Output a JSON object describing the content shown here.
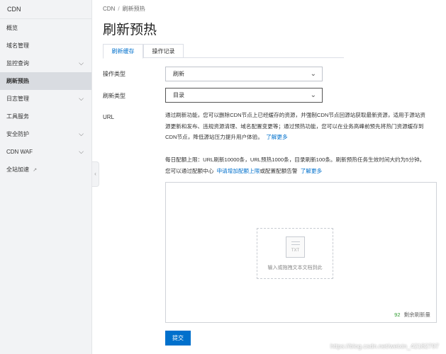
{
  "sidebar": {
    "title": "CDN",
    "items": [
      {
        "label": "概览",
        "has_chevron": false
      },
      {
        "label": "域名管理",
        "has_chevron": false
      },
      {
        "label": "监控查询",
        "has_chevron": true
      },
      {
        "label": "刷新预热",
        "has_chevron": false,
        "active": true
      },
      {
        "label": "日志管理",
        "has_chevron": true
      },
      {
        "label": "工具服务",
        "has_chevron": false
      },
      {
        "label": "安全防护",
        "has_chevron": true
      },
      {
        "label": "CDN WAF",
        "has_chevron": true
      },
      {
        "label": "全站加速",
        "has_chevron": false,
        "external": true
      }
    ]
  },
  "breadcrumb": {
    "root": "CDN",
    "separator": "/",
    "current": "刷新预热"
  },
  "page_title": "刷新预热",
  "tabs": [
    {
      "label": "刷新缓存",
      "active": true
    },
    {
      "label": "操作记录",
      "active": false
    }
  ],
  "form": {
    "operation_type": {
      "label": "操作类型",
      "value": "刷新"
    },
    "refresh_type": {
      "label": "刷新类型",
      "value": "目录"
    },
    "url": {
      "label": "URL",
      "desc_line1": "通过刷新功能，您可以删除CDN节点上已经缓存的资源，并强制CDN节点回源站获取最新资源，适用于源站资",
      "desc_line2": "源更新和发布、违规资源清理、域名配置变更等；通过预热功能，您可以在业务高峰前预先将热门资源缓存到",
      "desc_line3": "CDN节点，降低源站压力提升用户体验。",
      "learn_more_1": "了解更多",
      "quota_line": "每日配额上限：URL刷新10000条，URL预热1000条，目录刷新100条。刷新预热任务生效时间大约为5分钟。",
      "quota_prefix": "您可以通过配额中心",
      "quota_link": "申请增加配额上限",
      "quota_mid": "或配置配额告警",
      "learn_more_2": "了解更多",
      "drop_hint": "输入或拖拽文本文档到此",
      "doc_icon_label": "TXT",
      "remaining_count": "92",
      "remaining_label": "剩余刷新量"
    },
    "submit_label": "提交"
  },
  "watermark": "https://blog.csdn.net/weixin_42182797",
  "colors": {
    "accent": "#0070cc",
    "count_green": "#2e9a2e",
    "sidebar_bg": "#f2f3f5"
  }
}
